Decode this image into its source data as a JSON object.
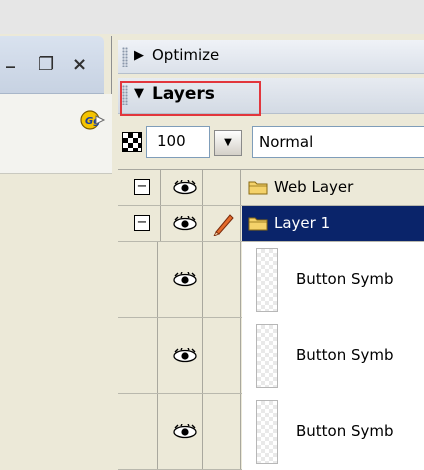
{
  "window_controls": {
    "minimize": "_",
    "restore": "❐",
    "close": "×"
  },
  "panels": {
    "optimize": {
      "label": "Optimize",
      "arrow": "▶"
    },
    "layers": {
      "label": "Layers",
      "arrow": "▼"
    }
  },
  "layer_props": {
    "opacity": "100",
    "dropdown_arrow": "▼",
    "blend_mode": "Normal"
  },
  "layers": [
    {
      "name": "Web Layer",
      "expander": "−",
      "selected": false,
      "icon": "folder-icon"
    },
    {
      "name": "Layer 1",
      "expander": "−",
      "selected": true,
      "icon": "folder-icon",
      "editing": true
    }
  ],
  "objects": [
    {
      "name": "Button Symb"
    },
    {
      "name": "Button Symb"
    },
    {
      "name": "Button Symb"
    }
  ],
  "colors": {
    "selected_row": "#0a246a",
    "highlight_box": "#e2363c"
  }
}
